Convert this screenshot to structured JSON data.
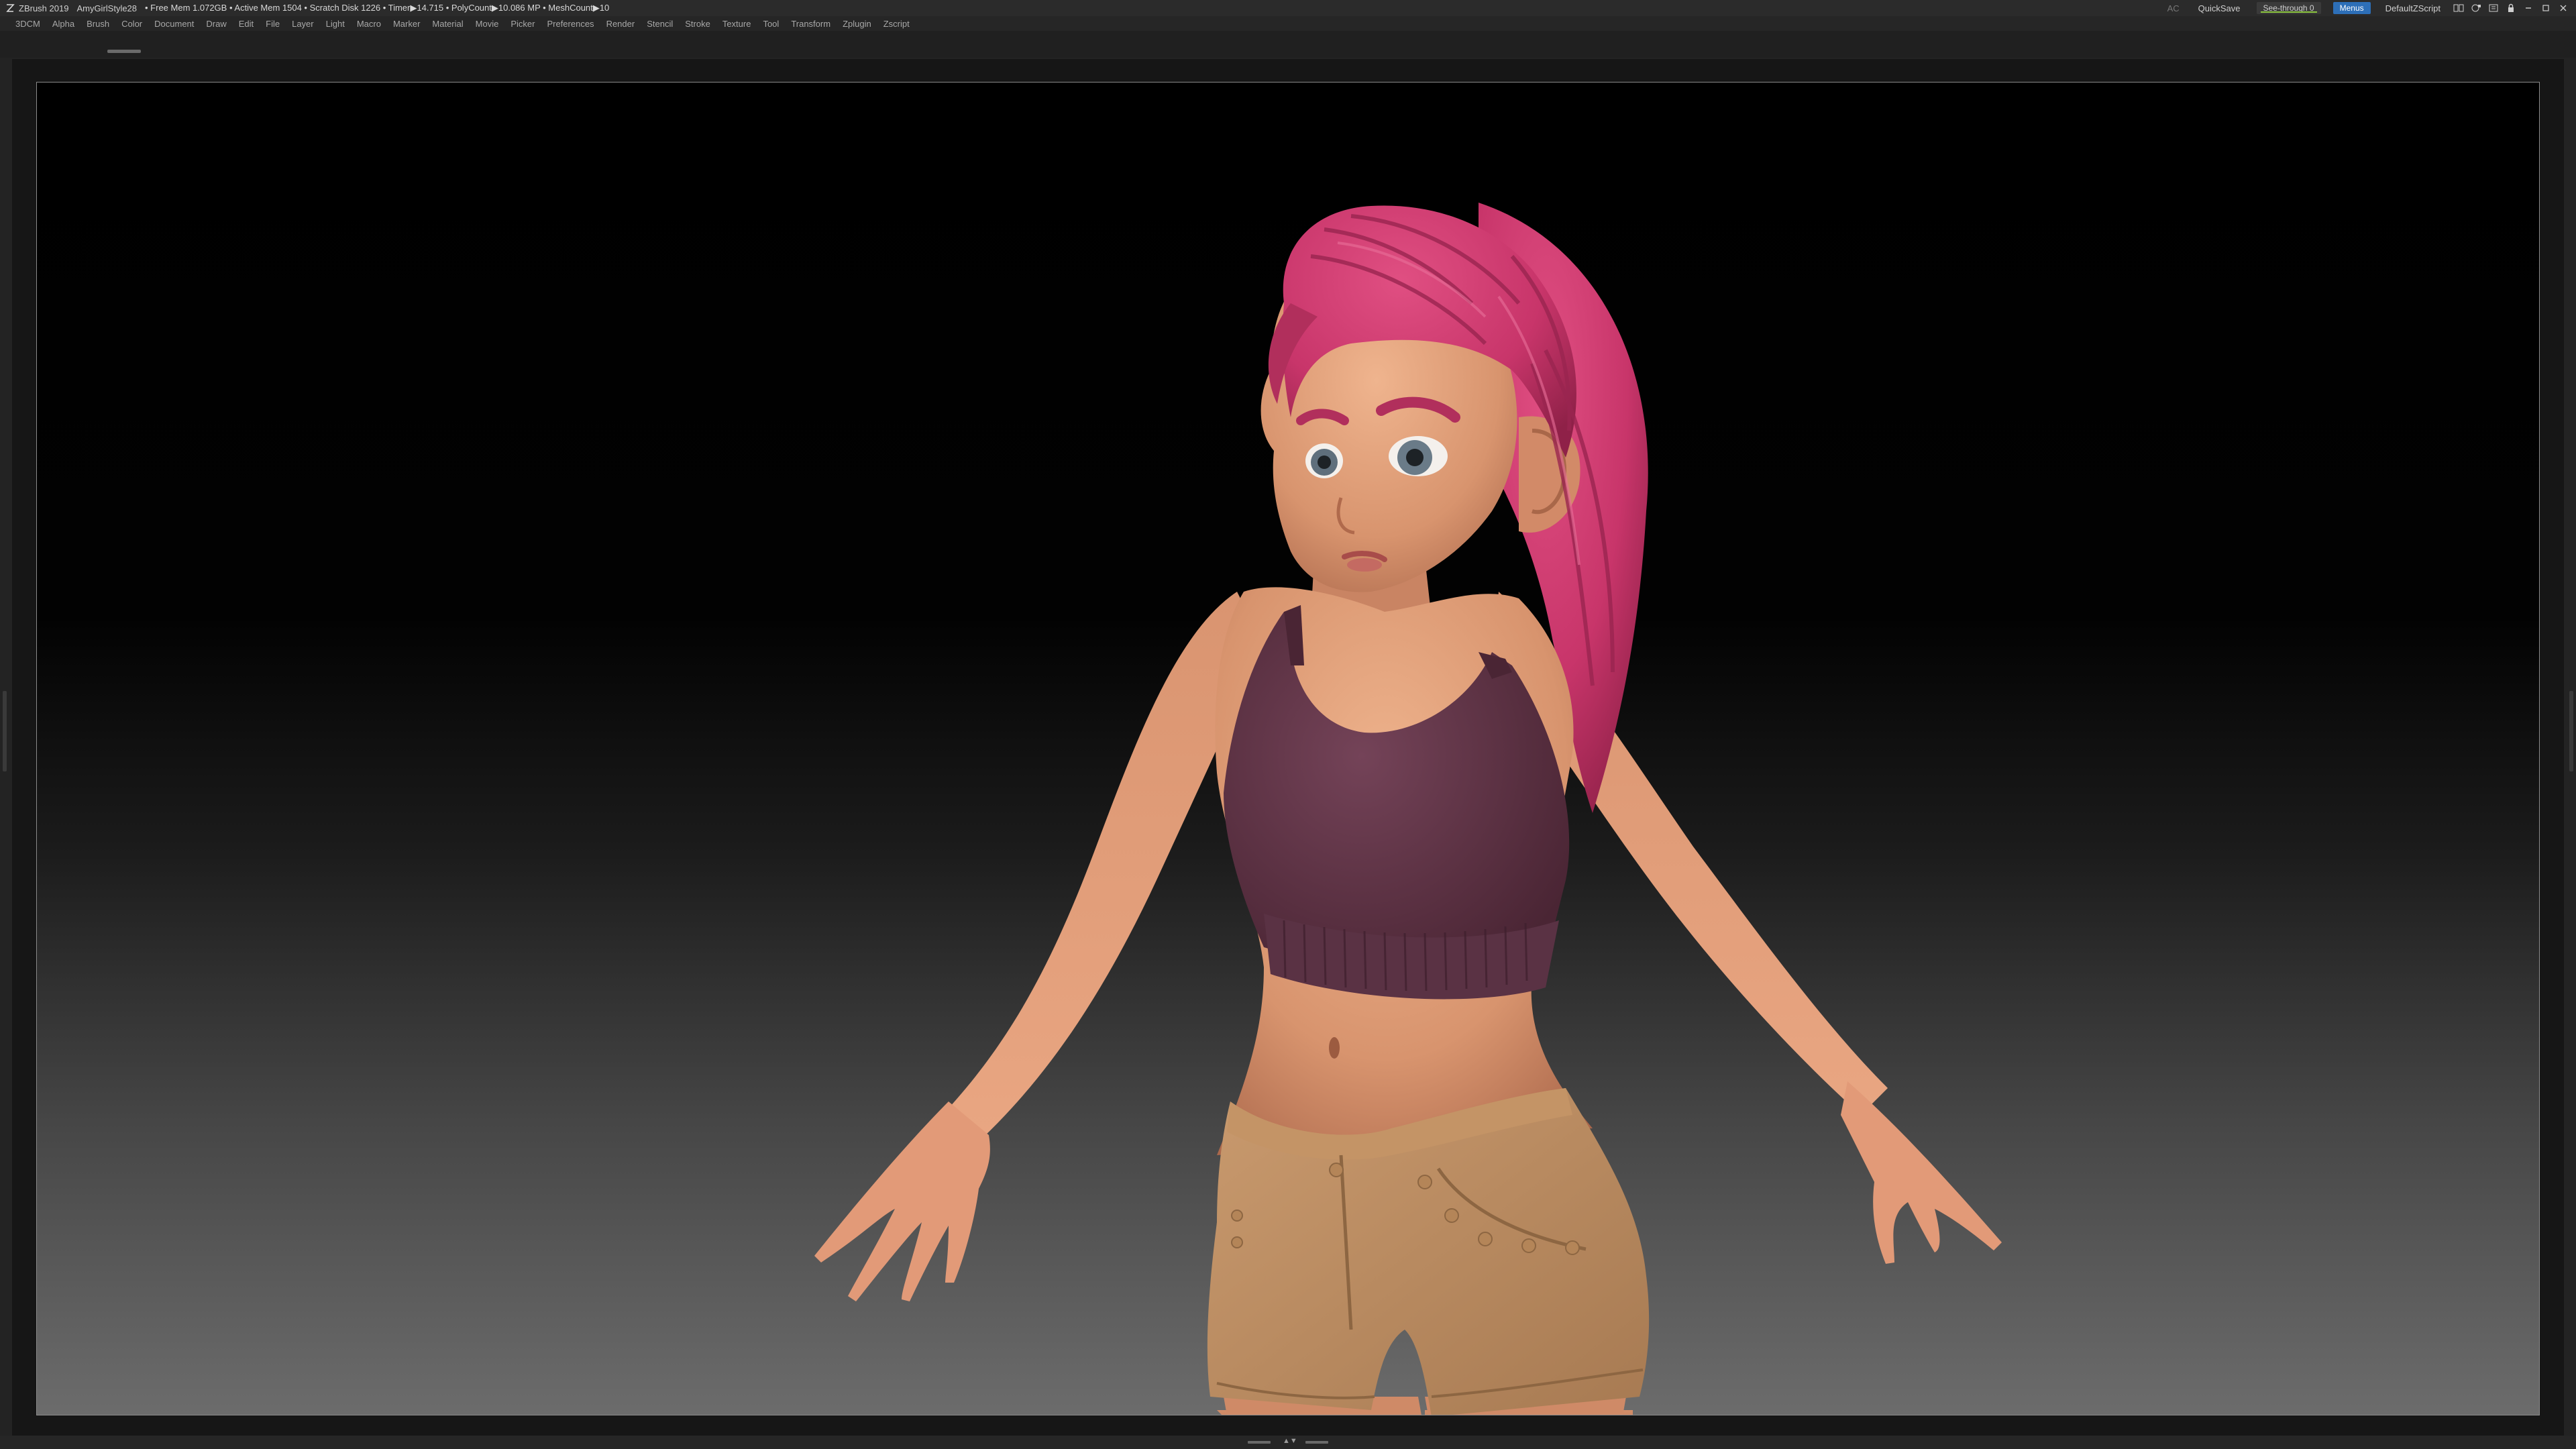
{
  "app": {
    "title": "ZBrush 2019",
    "document_name": "AmyGirlStyle28",
    "stats": "• Free Mem 1.072GB • Active Mem 1504 • Scratch Disk 1226 • Timer▶14.715 • PolyCount▶10.086 MP • MeshCount▶10"
  },
  "topbar_right": {
    "ac_label": "AC",
    "quicksave_label": "QuickSave",
    "see_through_label": "See-through 0",
    "menus_label": "Menus",
    "script_label": "DefaultZScript"
  },
  "menu": {
    "items": [
      "3DCM",
      "Alpha",
      "Brush",
      "Color",
      "Document",
      "Draw",
      "Edit",
      "File",
      "Layer",
      "Light",
      "Macro",
      "Marker",
      "Material",
      "Movie",
      "Picker",
      "Preferences",
      "Render",
      "Stencil",
      "Stroke",
      "Texture",
      "Tool",
      "Transform",
      "Zplugin",
      "Zscript"
    ]
  },
  "icons": {
    "logo": "zbrush-logo-icon",
    "window_controls": [
      "layout-icon",
      "interface-icon",
      "palette-icon",
      "lock-icon",
      "minimize-icon",
      "maximize-icon",
      "close-icon"
    ]
  },
  "colors": {
    "menus_active": "#2d6fb8",
    "see_through_bar": "#8cc63f",
    "hair": "#c8356a",
    "skin": "#d8946e",
    "top": "#5a3040",
    "shorts": "#b98a60"
  }
}
